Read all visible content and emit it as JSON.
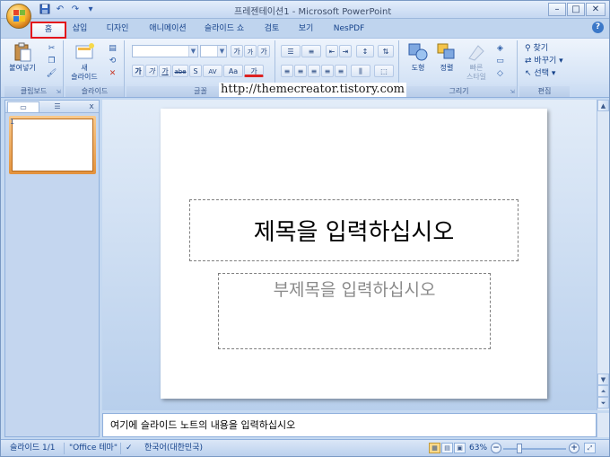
{
  "window": {
    "title": "프레젠테이션1 - Microsoft PowerPoint",
    "controls": {
      "minimize": "–",
      "maximize": "□",
      "close": "✕"
    }
  },
  "quick_access": [
    {
      "name": "save-icon",
      "glyph": "💾"
    },
    {
      "name": "undo-icon",
      "glyph": "↶"
    },
    {
      "name": "redo-icon",
      "glyph": "↷"
    },
    {
      "name": "customize-qat-icon",
      "glyph": "▾"
    }
  ],
  "tabs": [
    {
      "label": "홈",
      "active": true
    },
    {
      "label": "삽입",
      "active": false
    },
    {
      "label": "디자인",
      "active": false
    },
    {
      "label": "애니메이션",
      "active": false
    },
    {
      "label": "슬라이드 쇼",
      "active": false
    },
    {
      "label": "검토",
      "active": false
    },
    {
      "label": "보기",
      "active": false
    },
    {
      "label": "NesPDF",
      "active": false
    }
  ],
  "help_label": "?",
  "ribbon": {
    "clipboard": {
      "label": "클립보드",
      "paste_label": "붙여넣기"
    },
    "slides": {
      "label": "슬라이드",
      "new_slide_line1": "새",
      "new_slide_line2": "슬라이드"
    },
    "font": {
      "label": "글꼴",
      "bold": "가",
      "italic": "가",
      "underline": "가",
      "strike": "abe",
      "shadow": "S",
      "spacing": "AV",
      "case": "Aa",
      "color": "가",
      "grow": "가",
      "shrink": "가",
      "clear": "가"
    },
    "paragraph": {
      "label": "단락"
    },
    "drawing": {
      "label": "그리기",
      "shapes_label": "도형",
      "arrange_label": "정렬",
      "quick_styles_line1": "빠른",
      "quick_styles_line2": "스타일"
    },
    "editing": {
      "label": "편집",
      "find": "찾기",
      "replace": "바꾸기",
      "select": "선택"
    }
  },
  "watermark": "http://themecreator.tistory.com",
  "slides_pane": {
    "tab_slides": "▭",
    "tab_outline": "☰",
    "close": "x",
    "thumb_number": "1"
  },
  "slide": {
    "title_placeholder": "제목을 입력하십시오",
    "subtitle_placeholder": "부제목을 입력하십시오"
  },
  "notes_placeholder": "여기에 슬라이드 노트의 내용을 입력하십시오",
  "status": {
    "slide_count": "슬라이드 1/1",
    "theme": "\"Office 테마\"",
    "language": "한국어(대한민국)",
    "zoom": "63%",
    "zoom_out": "−",
    "zoom_in": "+"
  },
  "colors": {
    "ribbon": "#d6e4f6",
    "highlight": "#e3141b",
    "thumb_border": "#e3923c"
  }
}
